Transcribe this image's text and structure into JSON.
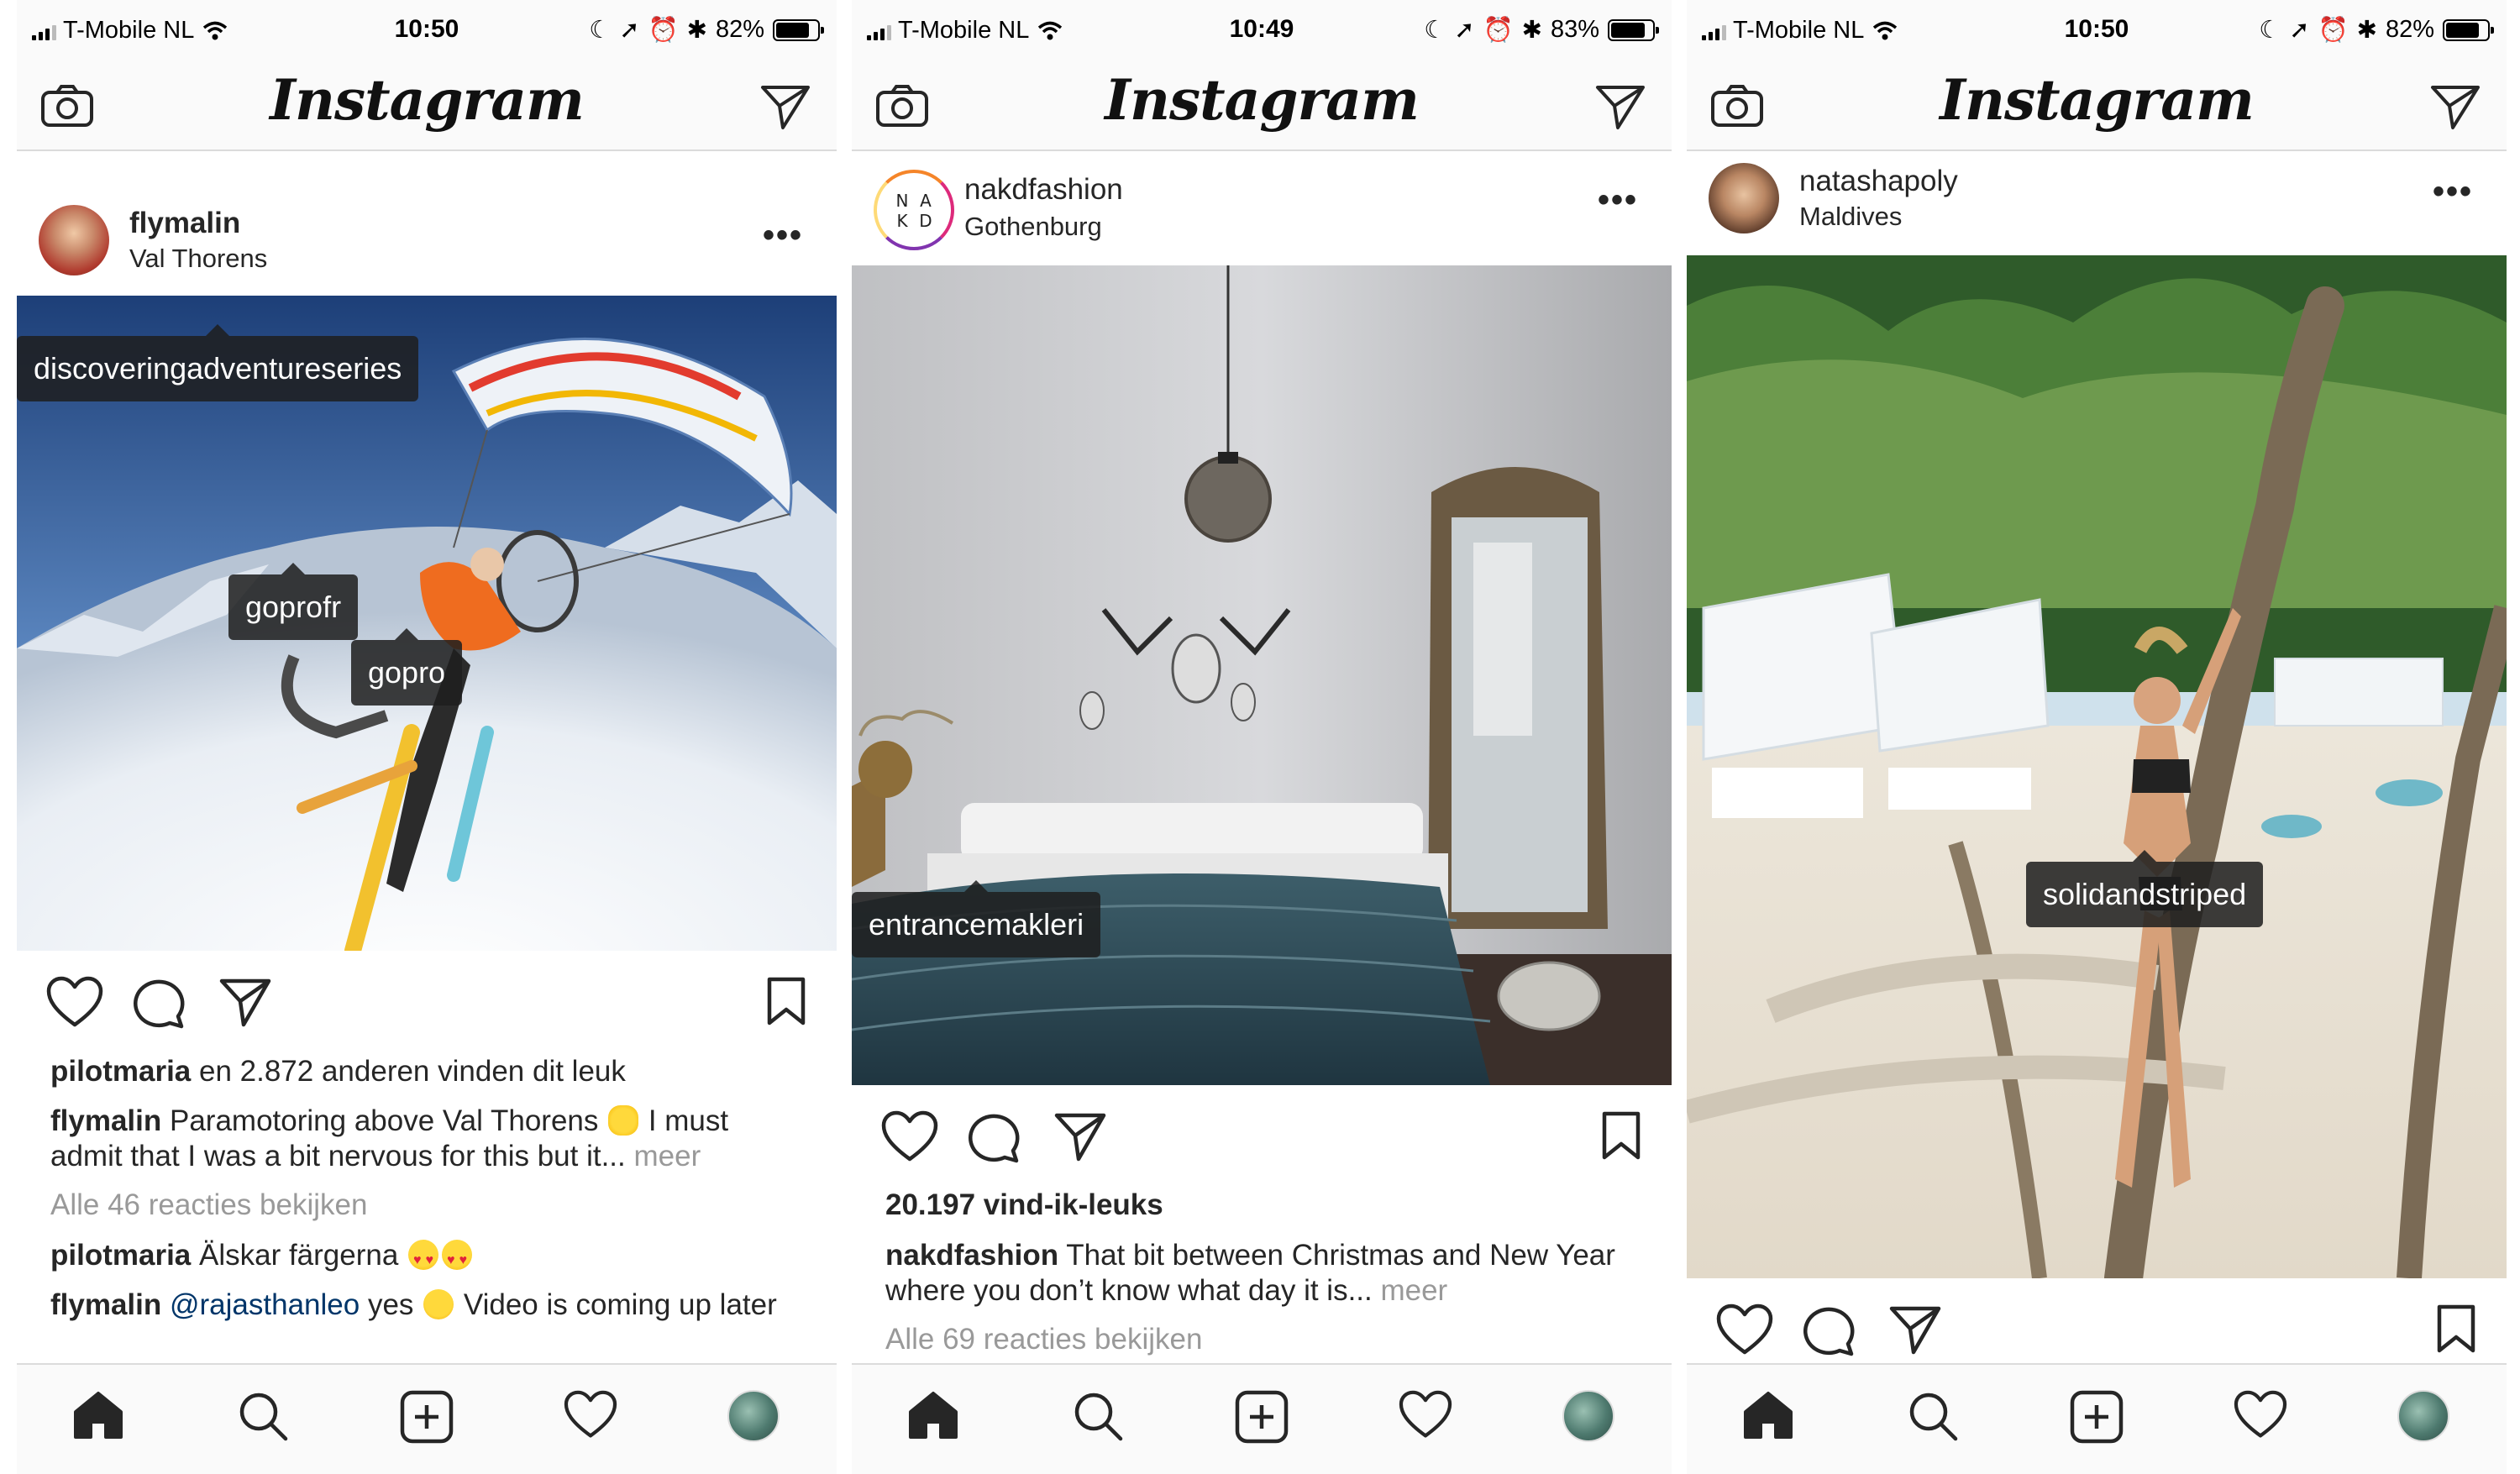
{
  "app": {
    "logo_text": "Instagram"
  },
  "colors": {
    "bar_bg": "#fafafa",
    "divider": "#dbdbdb",
    "text": "#262626",
    "muted": "#999999",
    "mention": "#003569",
    "tag_bg": "#1e1e1e"
  },
  "screens": [
    {
      "status": {
        "carrier": "T-Mobile NL",
        "time": "10:50",
        "battery": "82%",
        "battery_level": 0.82
      },
      "post": {
        "username": "flymalin",
        "location": "Val Thorens",
        "photo_tags": [
          "discoveringadventureseries",
          "goprofr",
          "gopro"
        ],
        "likes_user": "pilotmaria",
        "likes_rest": " en 2.872 anderen vinden dit leuk",
        "caption_user": "flymalin",
        "caption_text": " Paramotoring above Val Thorens ",
        "caption_text2": " I must admit that I was a bit nervous for this but it... ",
        "caption_more": "meer",
        "view_comments": "Alle 46 reacties bekijken",
        "comments": [
          {
            "user": "pilotmaria",
            "text": " Älskar färgerna "
          },
          {
            "user": "flymalin",
            "mention": "@rajasthanleo",
            "text": " yes ",
            "text2": " Video is coming up later"
          }
        ]
      }
    },
    {
      "status": {
        "carrier": "T-Mobile NL",
        "time": "10:49",
        "battery": "83%",
        "battery_level": 0.83
      },
      "post": {
        "username": "nakdfashion",
        "location": "Gothenburg",
        "avatar_letters": [
          "N",
          "A",
          "K",
          "D"
        ],
        "photo_tags": [
          "entrancemakleri"
        ],
        "likes_count": "20.197 vind-ik-leuks",
        "caption_user": "nakdfashion",
        "caption_text": " That bit between Christmas and New Year where you don’t know what day it is... ",
        "caption_more": "meer",
        "view_comments": "Alle 69 reacties bekijken"
      }
    },
    {
      "status": {
        "carrier": "T-Mobile NL",
        "time": "10:50",
        "battery": "82%",
        "battery_level": 0.82
      },
      "post": {
        "username": "natashapoly",
        "location": "Maldives",
        "photo_tags": [
          "solidandstriped"
        ]
      }
    }
  ],
  "icons": {
    "top": [
      "camera-icon",
      "direct-send-icon"
    ],
    "actions": [
      "heart-icon",
      "comment-icon",
      "share-icon",
      "bookmark-icon"
    ],
    "tabs": [
      "home-icon",
      "search-icon",
      "add-post-icon",
      "activity-heart-icon",
      "profile-avatar"
    ]
  }
}
